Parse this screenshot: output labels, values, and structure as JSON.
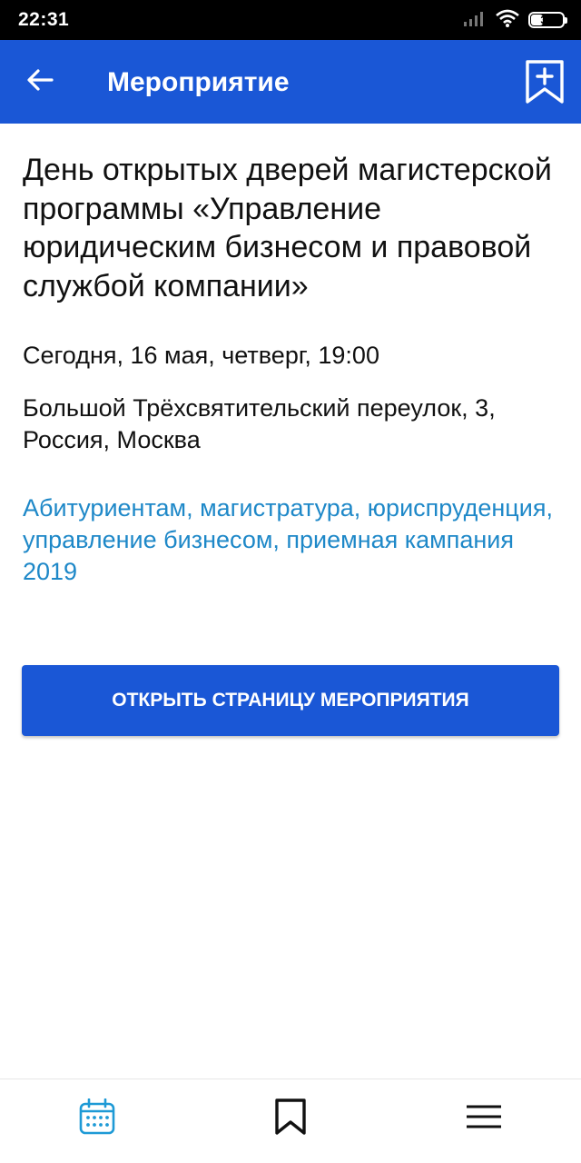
{
  "status_bar": {
    "time": "22:31",
    "battery": "38"
  },
  "app_bar": {
    "title": "Мероприятие",
    "back_icon": "arrow-left-icon",
    "action_icon": "bookmark-add-icon"
  },
  "event": {
    "title": "День открытых дверей магистерской программы «Управление юридическим бизнесом и правовой службой компании»",
    "date": "Сегодня, 16 мая, четверг, 19:00",
    "address": "Большой Трёхсвятительский переулок, 3, Россия, Москва",
    "tags": "Абитуриентам, магистратура, юриспруденция, управление бизнесом, приемная кампания 2019",
    "button_label": "ОТКРЫТЬ СТРАНИЦУ МЕРОПРИЯТИЯ"
  },
  "bottom_nav": [
    {
      "icon": "calendar-icon",
      "active": true
    },
    {
      "icon": "bookmark-icon",
      "active": false
    },
    {
      "icon": "menu-icon",
      "active": false
    }
  ],
  "colors": {
    "primary": "#1a57d6",
    "link": "#1e88c8",
    "nav_active": "#1e9ad6",
    "nav_inactive": "#111111"
  }
}
